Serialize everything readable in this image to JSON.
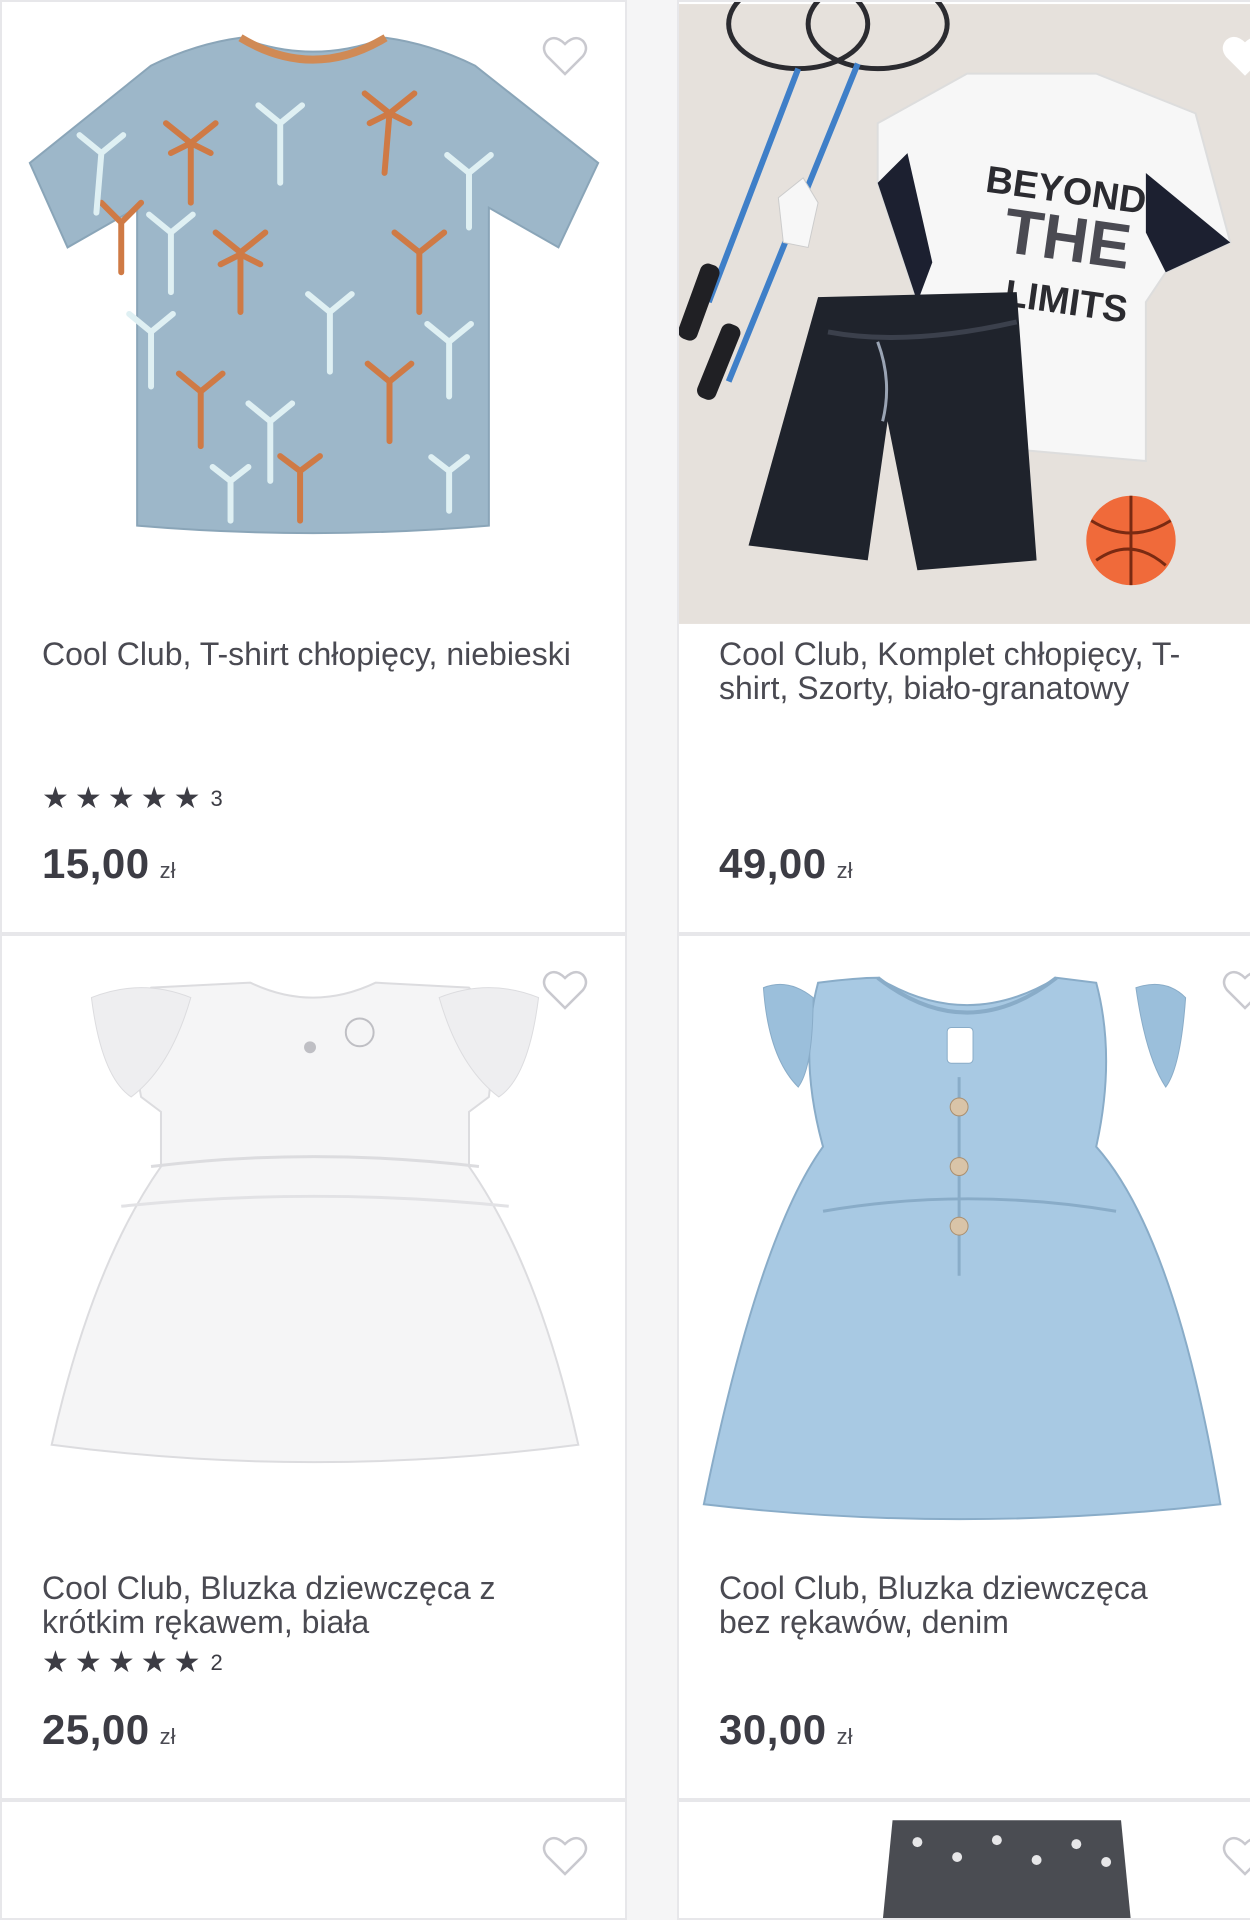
{
  "products": [
    {
      "title": "Cool Club, T-shirt chłopięcy, niebieski",
      "rating_count": "3",
      "price": "15,00",
      "currency": "zł",
      "image": "blue-palm-tshirt"
    },
    {
      "title": "Cool Club, Komplet chłopięcy, T-shirt, Szorty, biało-granatowy",
      "price": "49,00",
      "currency": "zł",
      "image": "tshirt-shorts-set",
      "print_text": [
        "BEYOND",
        "THE",
        "LIMITS"
      ]
    },
    {
      "title": "Cool Club, Bluzka dziewczęca z krótkim rękawem, biała",
      "rating_count": "2",
      "price": "25,00",
      "currency": "zł",
      "image": "white-blouse"
    },
    {
      "title": "Cool Club, Bluzka dziewczęca bez rękawów, denim",
      "price": "30,00",
      "currency": "zł",
      "image": "denim-blouse"
    }
  ],
  "icons": {
    "favorite": "heart-outline-icon",
    "rating": "star-icon"
  },
  "colors": {
    "background": "#f5f5f6",
    "card": "#ffffff",
    "text": "#3c3c44",
    "border": "#e7e7ea"
  }
}
